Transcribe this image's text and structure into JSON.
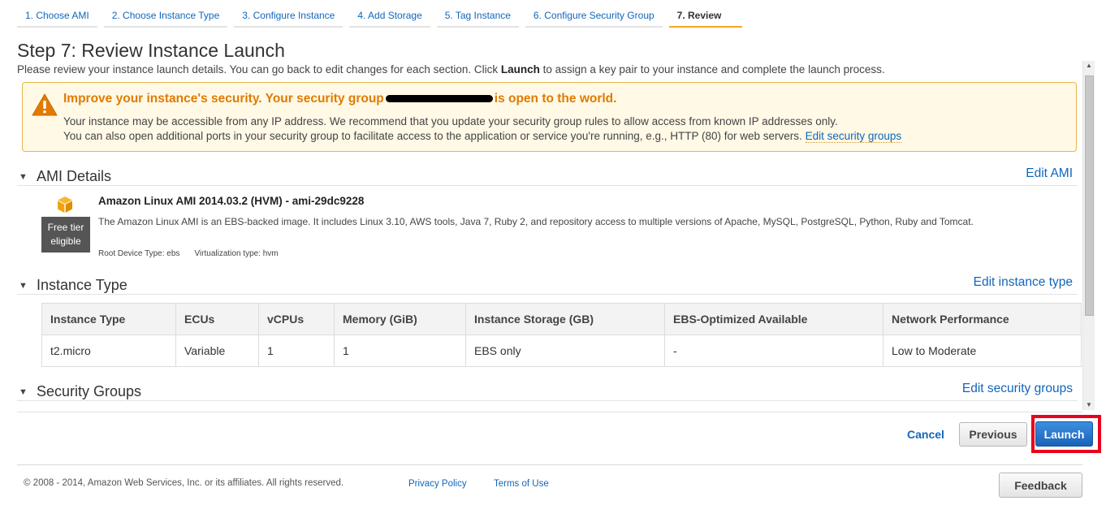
{
  "wizard": {
    "steps": [
      {
        "label": "1. Choose AMI"
      },
      {
        "label": "2. Choose Instance Type"
      },
      {
        "label": "3. Configure Instance"
      },
      {
        "label": "4. Add Storage"
      },
      {
        "label": "5. Tag Instance"
      },
      {
        "label": "6. Configure Security Group"
      },
      {
        "label": "7. Review"
      }
    ],
    "active_step": "7. Review"
  },
  "page": {
    "title": "Step 7: Review Instance Launch",
    "subtitle_before": "Please review your instance launch details. You can go back to edit changes for each section. Click ",
    "subtitle_bold": "Launch",
    "subtitle_after": " to assign a key pair to your instance and complete the launch process."
  },
  "warning": {
    "title_before": "Improve your instance's security. Your security group",
    "title_after": "is open to the world.",
    "line1": "Your instance may be accessible from any IP address. We recommend that you update your security group rules to allow access from known IP addresses only.",
    "line2": "You can also open additional ports in your security group to facilitate access to the application or service you're running, e.g., HTTP (80) for web servers.",
    "edit_link": "Edit security groups",
    "icon": "warning-triangle-icon"
  },
  "ami_section": {
    "title": "AMI Details",
    "edit_link": "Edit AMI",
    "badge": "Free tier eligible",
    "name": "Amazon Linux AMI 2014.03.2 (HVM) - ami-29dc9228",
    "description": "The Amazon Linux AMI is an EBS-backed image. It includes Linux 3.10, AWS tools, Java 7, Ruby 2, and repository access to multiple versions of Apache, MySQL, PostgreSQL, Python, Ruby and Tomcat.",
    "root_device": "Root Device Type: ebs",
    "virtualization": "Virtualization type: hvm",
    "icon": "amazon-cube-icon"
  },
  "instance_section": {
    "title": "Instance Type",
    "edit_link": "Edit instance type",
    "headers": [
      "Instance Type",
      "ECUs",
      "vCPUs",
      "Memory (GiB)",
      "Instance Storage (GB)",
      "EBS-Optimized Available",
      "Network Performance"
    ],
    "rows": [
      [
        "t2.micro",
        "Variable",
        "1",
        "1",
        "EBS only",
        "-",
        "Low to Moderate"
      ]
    ]
  },
  "security_section": {
    "title": "Security Groups",
    "edit_link": "Edit security groups"
  },
  "actions": {
    "cancel": "Cancel",
    "previous": "Previous",
    "launch": "Launch",
    "highlight_color": "#e8001c"
  },
  "footer": {
    "copyright": "© 2008 - 2014, Amazon Web Services, Inc. or its affiliates. All rights reserved.",
    "privacy": "Privacy Policy",
    "terms": "Terms of Use",
    "feedback": "Feedback"
  },
  "colors": {
    "link": "#1166bb",
    "warning_title": "#e07b00",
    "warning_bg": "#fff9e6",
    "active_step_underline": "#f5a623",
    "launch_button": "#1a62b8"
  }
}
